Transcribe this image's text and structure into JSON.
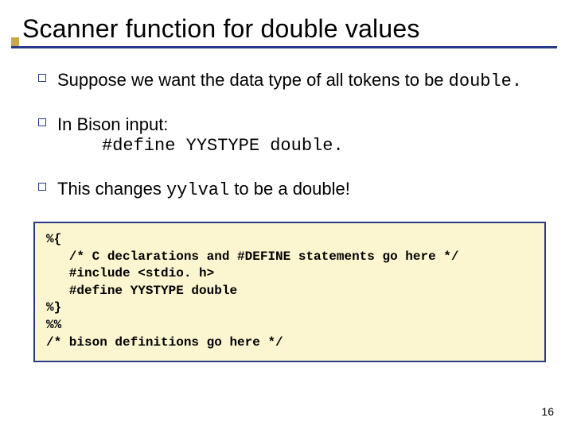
{
  "title": "Scanner function for double values",
  "bullets": {
    "b1": {
      "text_a": "Suppose we want the data type of all tokens to be ",
      "code_a": "double."
    },
    "b2": {
      "text_a": "In Bison input:",
      "indent_code": "#define YYSTYPE double."
    },
    "b3": {
      "text_a": "This changes ",
      "code_a": "yylval",
      "text_b": " to be a double!"
    }
  },
  "codebox": "%{\n   /* C declarations and #DEFINE statements go here */\n   #include <stdio. h>\n   #define YYSTYPE double\n%}\n%%\n/* bison definitions go here */",
  "page_number": "16"
}
